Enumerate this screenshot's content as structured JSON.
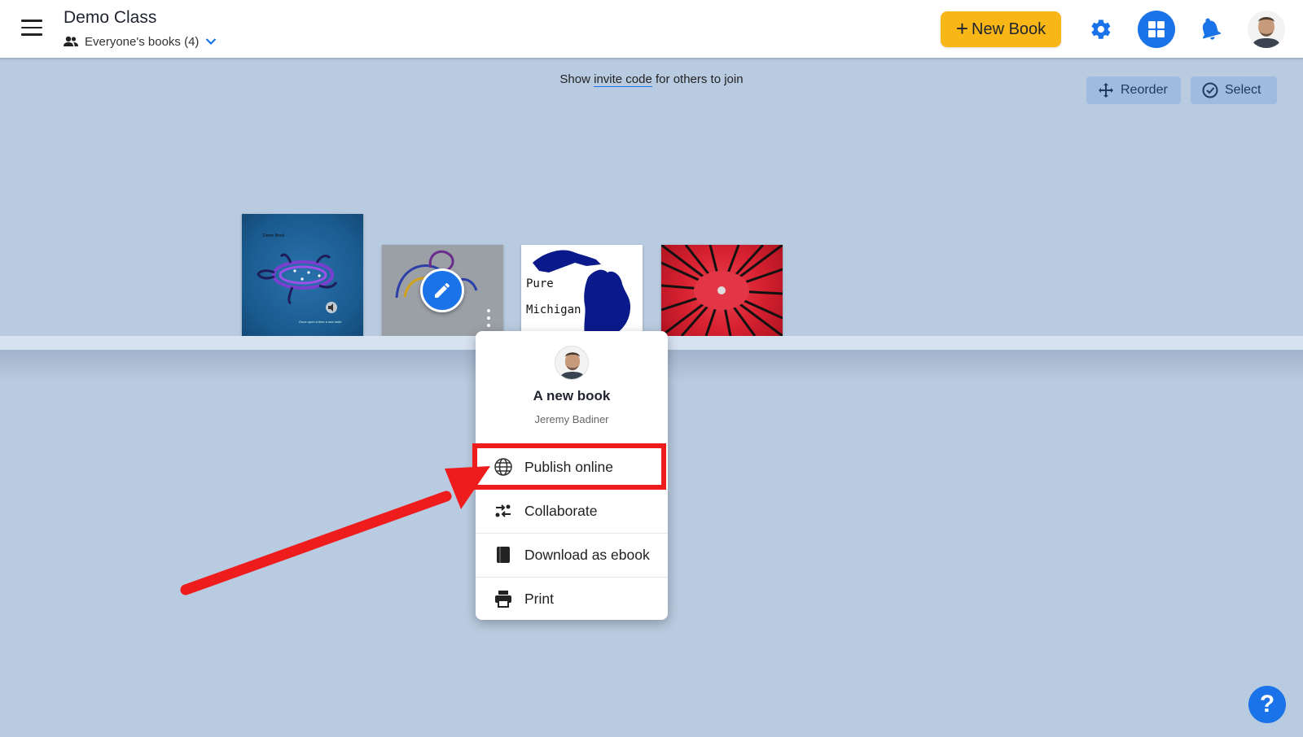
{
  "header": {
    "class_title": "Demo Class",
    "filter_label": "Everyone's books (4)",
    "new_book_label": "New Book",
    "new_book_plus": "+",
    "icons": {
      "menu": "hamburger-menu-icon",
      "people": "people-icon",
      "filter_dropdown": "chevron-down-icon",
      "settings": "gear-icon",
      "layout": "grid-icon",
      "notifications": "bell-icon",
      "account": "avatar"
    }
  },
  "subheader": {
    "invite_prefix": "Show",
    "invite_link": "invite code",
    "invite_suffix": "for others to join",
    "reorder_label": "Reorder",
    "select_label": "Select"
  },
  "bookshelf": {
    "books": [
      {
        "cover_title": "Demo Book",
        "cover_caption": "Once upon a time a sea turtle",
        "color": "#1a5a8e"
      },
      {
        "color": "#9aa0a6"
      },
      {
        "cover_line1": "Pure",
        "cover_line2": "Michigan",
        "color": "#ffffff"
      },
      {
        "color": "#d92232"
      }
    ]
  },
  "book_menu": {
    "title": "A new book",
    "author": "Jeremy Badiner",
    "items": [
      {
        "label": "Publish online",
        "icon": "globe-icon"
      },
      {
        "label": "Collaborate",
        "icon": "collaborate-icon"
      },
      {
        "label": "Download as ebook",
        "icon": "book-icon"
      },
      {
        "label": "Print",
        "icon": "printer-icon"
      }
    ]
  },
  "help": {
    "label": "?"
  },
  "colors": {
    "accent": "#1a73e8",
    "new_book": "#f9b617",
    "background": "#b9cbe0",
    "annotation_red": "#ee1c1c"
  }
}
